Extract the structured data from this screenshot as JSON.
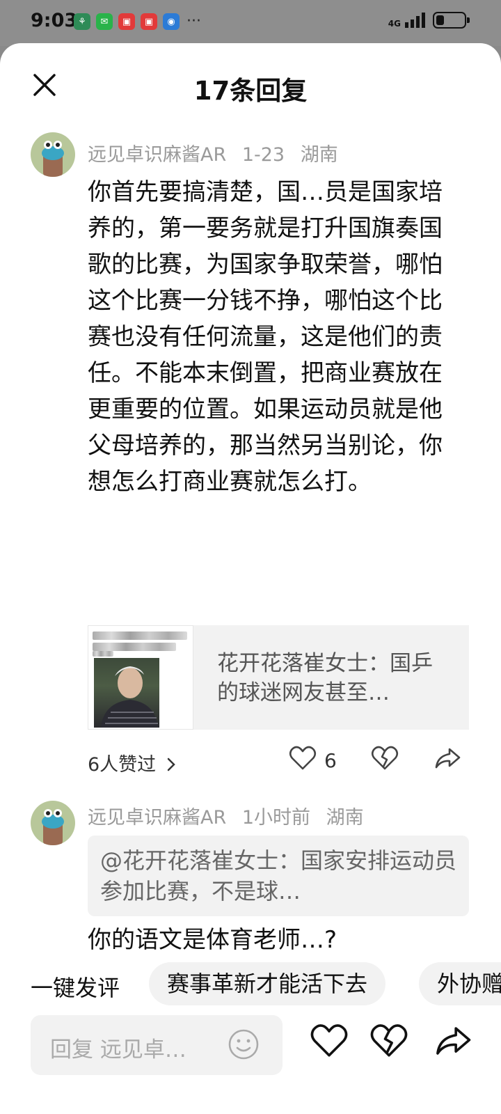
{
  "status_bar": {
    "time": "9:03",
    "network_label": "4G",
    "more": "···",
    "battery_level": 0.3
  },
  "header": {
    "title": "17条回复"
  },
  "comments": [
    {
      "author": "远见卓识麻酱AR",
      "date": "1-23",
      "location": "湖南",
      "body": "你首先要搞清楚，国…员是国家培养的，第一要务就是打升国旗奏国歌的比赛，为国家争取荣誉，哪怕这个比赛一分钱不挣，哪怕这个比赛也没有任何流量，这是他们的责任。不能本末倒置，把商业赛放在更重要的位置。如果运动员就是他父母培养的，那当然另当别论，你想怎么打商业赛就怎么打。",
      "link_card_title": "花开花落崔女士：国乒的球迷网友甚至…",
      "likes_summary": "6人赞过",
      "like_count": "6"
    },
    {
      "author": "远见卓识麻酱AR",
      "date": "1小时前",
      "location": "湖南",
      "quote": "@花开花落崔女士：国家安排运动员参加比赛，不是球…",
      "body": "你的语文是体育老师…?"
    }
  ],
  "quick_replies": {
    "label": "一键发评",
    "chips": [
      "赛事革新才能活下去",
      "外协赠"
    ]
  },
  "reply_bar": {
    "placeholder": "回复 远见卓…"
  },
  "colors": {
    "muted_text": "#9a9a9a",
    "card_bg": "#f2f2f2",
    "avatar_bg": "#b8c79a"
  },
  "icons": [
    "close-icon",
    "heart-icon",
    "broken-heart-icon",
    "share-icon",
    "emoji-icon",
    "chevron-right-icon"
  ]
}
